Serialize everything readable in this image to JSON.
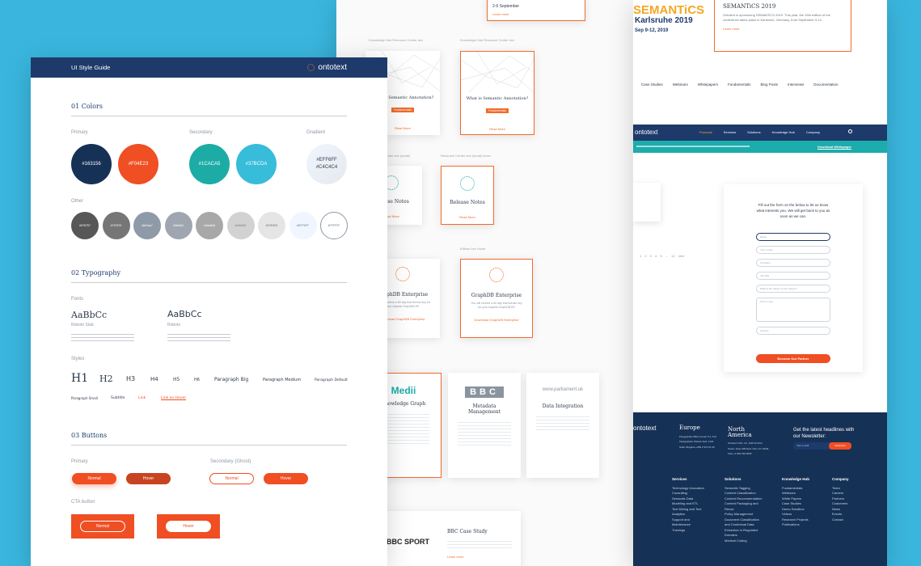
{
  "guide": {
    "title": "UI Style Guide",
    "logo": "ontotext",
    "colors": {
      "heading": "01 Colors",
      "primary_label": "Primary",
      "secondary_label": "Secondary",
      "gradient_label": "Gradient",
      "other_label": "Other",
      "primary": [
        "#163156",
        "#F04E23"
      ],
      "secondary": [
        "#1CACA5",
        "#37BCDA"
      ],
      "gradient": [
        "#EFF6FF",
        "#C4C4C4"
      ],
      "other": [
        "#575757",
        "#767676",
        "#8e9aa7",
        "#9fa6b0",
        "#a8a8a8",
        "#d2d2d2",
        "#E5E5E5",
        "#EFF6FF",
        "#FFFFFF"
      ]
    },
    "typography": {
      "heading": "02 Typography",
      "fonts_label": "Fonts",
      "font1_sample": "AaBbCc",
      "font1_name": "Roboto Slab",
      "font2_sample": "AaBbCc",
      "font2_name": "Roboto",
      "styles_label": "Styles",
      "styles": [
        "H1",
        "H2",
        "H3",
        "H4",
        "H5",
        "H6",
        "Paragraph Big",
        "Paragraph Medium",
        "Paragraph Default"
      ],
      "styles2": [
        "Paragraph Small",
        "Subtitle",
        "Link",
        "Link on Hover"
      ]
    },
    "buttons": {
      "heading": "03 Buttons",
      "primary_label": "Primary",
      "secondary_label": "Secondary (Ghost)",
      "cta_label": "CTA button",
      "normal": "Normal",
      "hover": "Hover"
    }
  },
  "mid": {
    "event_date": "2-6 September",
    "learn_more": "Learn more",
    "caption1": "Knowledge Hub Resource Center box",
    "caption2": "Knowledge Hub Resource Center box",
    "card1_title": "What is Semantic Annotation?",
    "card2_title": "What is Semantic Annotation?",
    "badge": "Fundamentals",
    "read_more": "Read More",
    "caption3": "Resource Center box (small)",
    "caption4": "Resource Center box (small) hover",
    "card3_title": "Release Notes",
    "card4_title": "Release Notes",
    "caption5": "Edition box Hover",
    "card5_title": "GraphDB Enterprise",
    "card6_title": "GraphDB Enterprise",
    "card6_body": "You will receive a 60 day trial license key for your request GraphDB EE",
    "card6_link": "Download GraphDB Enterprise",
    "card7_title": "Knowledge Graph",
    "card7_logo": "Medii",
    "card8_logo": "BBC",
    "card8_title": "Metadata Management",
    "card9_logo": "www.parliament.uk",
    "card9_title": "Data Integration",
    "card10_logo": "BBC SPORT",
    "card10_title": "BBC Case Study"
  },
  "right": {
    "banner_title": "SEMANTiCS",
    "banner_sub": "Karlsruhe 2019",
    "banner_date": "Sep 9-12, 2019",
    "event_title": "SEMANTiCS 2019",
    "event_text": "Ontotext is sponsoring SEMANTiCS 2019. This year, the 15th edition of the conference takes place in Karlsruhe, Germany, from September 9-12.",
    "learn_more": "Learn more",
    "nav1": [
      "Case Studies",
      "Webinars",
      "Whitepapers",
      "Fundamentals",
      "Blog Posts",
      "Interviews",
      "Documentation"
    ],
    "logo": "ontotext",
    "nav2": [
      "Products",
      "Services",
      "Solutions",
      "Knowledge Hub",
      "Company"
    ],
    "announcement": "Download Whitepaper",
    "pagination": "1 2 3 4 5 ... 12 next",
    "form_intro": "Fill out the form on the below to let us know what interests you. We will get back to you as soon as we can.",
    "fields": [
      "Name",
      "Your e-mail",
      "Company",
      "Job Title",
      "What is the nature of your inquiry?",
      "Tell us more",
      "Country"
    ],
    "submit": "Become Our Partner",
    "footer": {
      "europe": "Europe",
      "europe_addr": "Polygraphia Office Center fl.4, 47A Tsarigradsko Shosse blvd, 1124 Sofia, Bulgaria +359 2 974 61 60",
      "na": "North America",
      "na_addr": "Ontotext USA, Inc. 1115 W 23rd Street, Suite 309 New York, NY 10011, USA +1 929 239 0659",
      "newsletter": "Get the latest headlines with our Newsletter:",
      "email_ph": "Your e-mail",
      "subscribe": "Subscribe",
      "services": "Services",
      "services_items": [
        "Technology Innovation Consulting",
        "Semantic Data Modeling and ETL",
        "Text Mining and Text Analytics",
        "Support and Maintenance",
        "Trainings"
      ],
      "solutions": "Solutions",
      "solutions_items": [
        "Semantic Tagging",
        "Content Classification",
        "Content Recommendation",
        "Content Packaging and Reuse",
        "Policy Management",
        "Document Classification and Contextual Data Extraction in Regulated Domains",
        "Medical Coding"
      ],
      "hub": "Knowledge Hub",
      "hub_items": [
        "Fundamentals",
        "Webinars",
        "White Papers",
        "Case Studies",
        "Demo Sandbox",
        "Videos",
        "Research Projects",
        "Publications"
      ],
      "company": "Company",
      "company_items": [
        "Team",
        "Careers",
        "Partners",
        "Customers",
        "News",
        "Events",
        "Contact"
      ]
    }
  }
}
